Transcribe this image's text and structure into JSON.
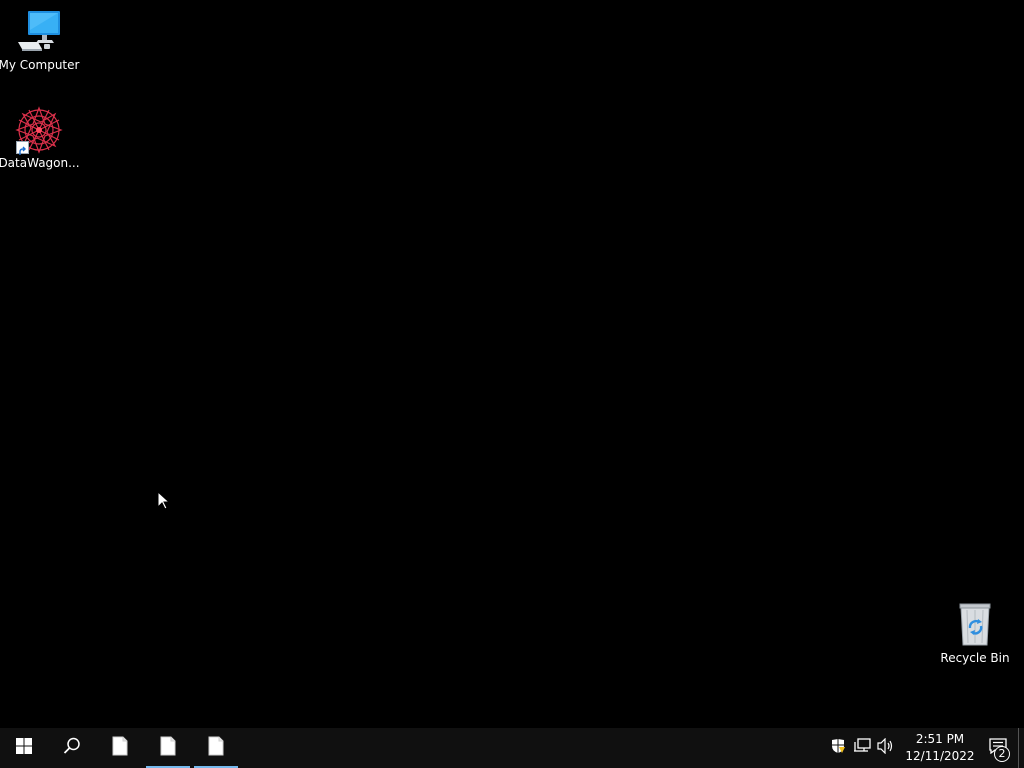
{
  "desktop": {
    "background_color": "#000000",
    "icons": [
      {
        "label": "My Computer",
        "icon": "computer-icon"
      },
      {
        "label": "DataWagon...",
        "icon": "datawagon-logo-icon",
        "shortcut": true
      },
      {
        "label": "Recycle Bin",
        "icon": "recycle-bin-icon"
      }
    ]
  },
  "taskbar": {
    "start_icon": "windows-logo-icon",
    "search_icon": "search-icon",
    "apps": [
      {
        "icon": "document-icon",
        "active": false
      },
      {
        "icon": "document-icon",
        "active": true
      },
      {
        "icon": "document-icon",
        "active": true
      }
    ],
    "tray": {
      "icons": [
        "security-warning-icon",
        "network-icon",
        "volume-icon"
      ],
      "time": "2:51 PM",
      "date": "12/11/2022",
      "notification_count": "2"
    },
    "accent_color": "#76b9ed"
  }
}
